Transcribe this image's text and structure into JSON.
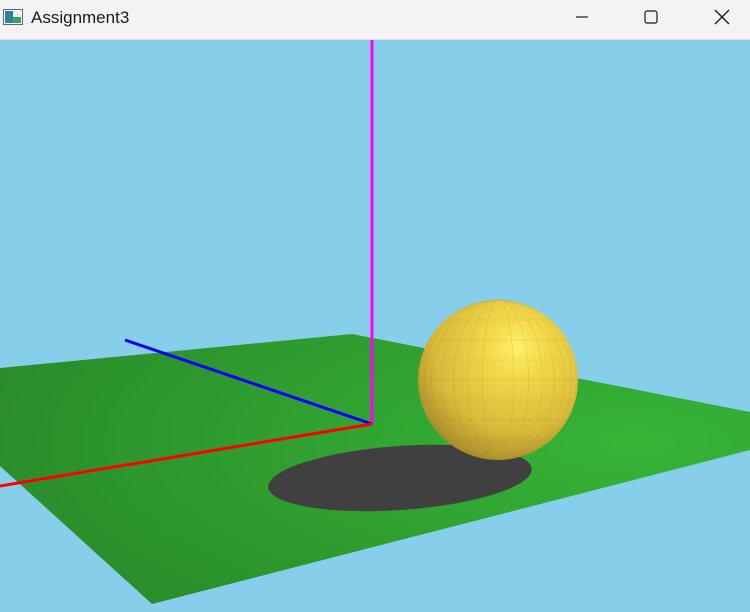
{
  "window": {
    "title": "Assignment3",
    "icon": "app-window-icon",
    "controls": {
      "minimize_icon": "minimize-icon",
      "maximize_icon": "maximize-icon",
      "close_icon": "close-icon"
    }
  },
  "scene": {
    "background_color": "#87ceea",
    "ground_color": "#32a832",
    "sphere_color": "#e9cc3f",
    "shadow_color": "#404040",
    "axes": {
      "x_color": "#ff0000",
      "y_color": "#ff00ff",
      "z_color": "#0000ff"
    }
  }
}
